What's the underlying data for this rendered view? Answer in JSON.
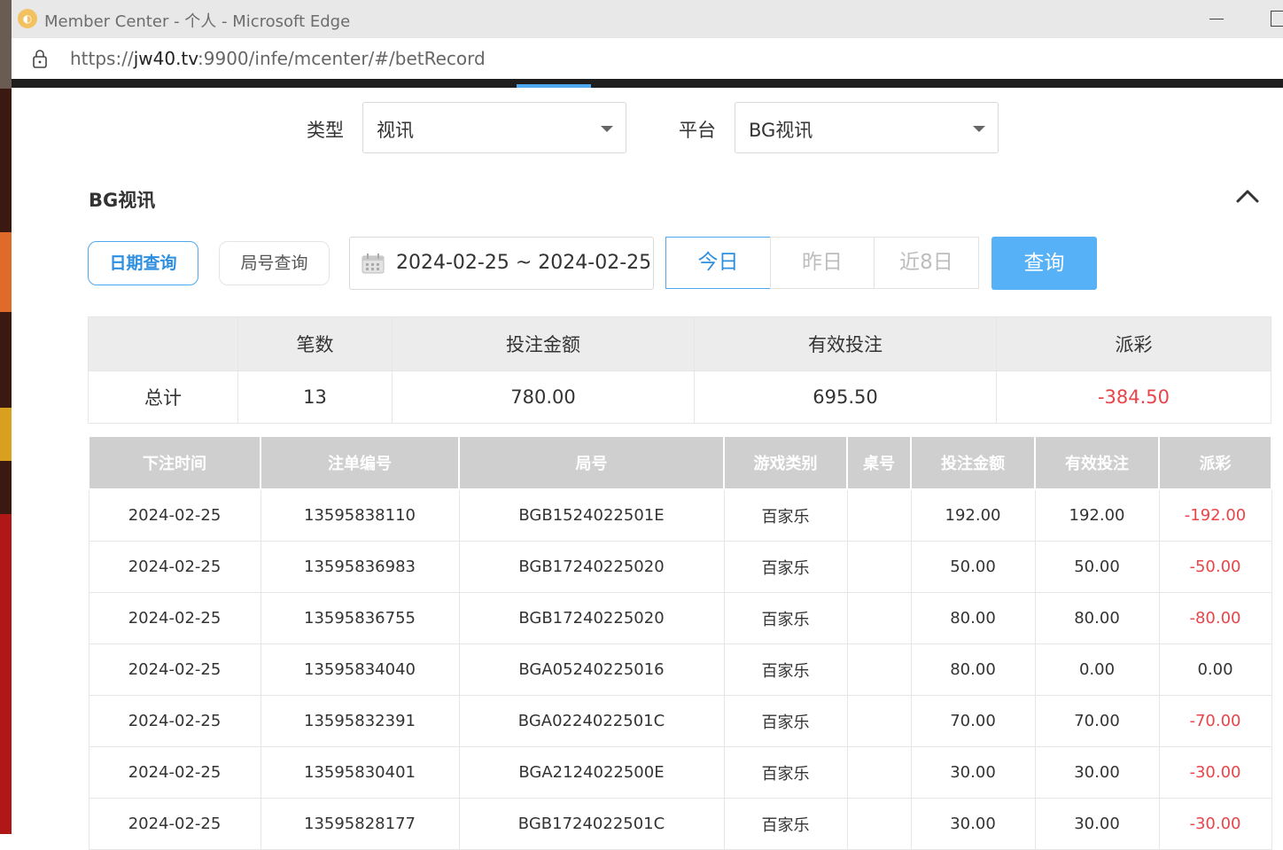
{
  "window": {
    "title": "Member Center - 个人 - Microsoft Edge",
    "url_prefix": "https://",
    "url_host": "jw40.tv",
    "url_rest": ":9900/infe/mcenter/#/betRecord"
  },
  "filters": {
    "type_label": "类型",
    "type_value": "视讯",
    "platform_label": "平台",
    "platform_value": "BG视讯"
  },
  "section": {
    "title": "BG视讯"
  },
  "query": {
    "tab_date": "日期查询",
    "tab_round": "局号查询",
    "date_range": "2024-02-25 ~ 2024-02-25",
    "range_today": "今日",
    "range_yesterday": "昨日",
    "range_8days": "近8日",
    "submit": "查询"
  },
  "summary": {
    "headers": [
      "",
      "笔数",
      "投注金额",
      "有效投注",
      "派彩"
    ],
    "row": [
      "总计",
      "13",
      "780.00",
      "695.50",
      "-384.50"
    ]
  },
  "records": {
    "headers": [
      "下注时间",
      "注单编号",
      "局号",
      "游戏类别",
      "桌号",
      "投注金额",
      "有效投注",
      "派彩"
    ],
    "rows": [
      [
        "2024-02-25",
        "13595838110",
        "BGB1524022501E",
        "百家乐",
        "",
        "192.00",
        "192.00",
        "-192.00"
      ],
      [
        "2024-02-25",
        "13595836983",
        "BGB17240225020",
        "百家乐",
        "",
        "50.00",
        "50.00",
        "-50.00"
      ],
      [
        "2024-02-25",
        "13595836755",
        "BGB17240225020",
        "百家乐",
        "",
        "80.00",
        "80.00",
        "-80.00"
      ],
      [
        "2024-02-25",
        "13595834040",
        "BGA05240225016",
        "百家乐",
        "",
        "80.00",
        "0.00",
        "0.00"
      ],
      [
        "2024-02-25",
        "13595832391",
        "BGA0224022501C",
        "百家乐",
        "",
        "70.00",
        "70.00",
        "-70.00"
      ],
      [
        "2024-02-25",
        "13595830401",
        "BGA2124022500E",
        "百家乐",
        "",
        "30.00",
        "30.00",
        "-30.00"
      ],
      [
        "2024-02-25",
        "13595828177",
        "BGB1724022501C",
        "百家乐",
        "",
        "30.00",
        "30.00",
        "-30.00"
      ]
    ]
  },
  "colors": {
    "accent": "#4ea8ef",
    "negative": "#e8454a",
    "header_gray": "#cfcfcf"
  }
}
